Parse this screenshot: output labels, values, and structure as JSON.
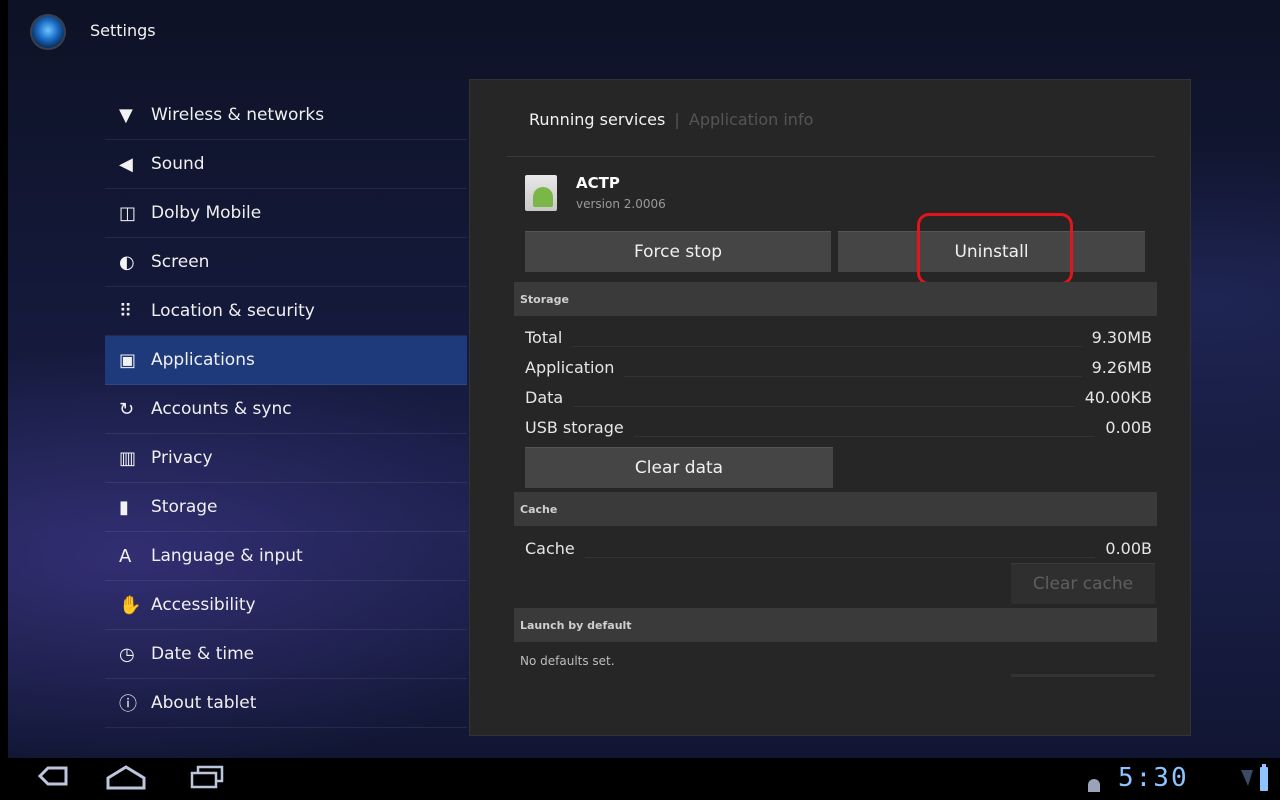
{
  "titlebar": {
    "title": "Settings"
  },
  "nav": {
    "items": [
      {
        "icon": "▼",
        "icon_name": "wifi-icon",
        "label": "Wireless & networks"
      },
      {
        "icon": "◀",
        "icon_name": "speaker-icon",
        "label": "Sound"
      },
      {
        "icon": "◫",
        "icon_name": "dolby-icon",
        "label": "Dolby Mobile"
      },
      {
        "icon": "◐",
        "icon_name": "brightness-icon",
        "label": "Screen"
      },
      {
        "icon": "⠿",
        "icon_name": "lock-grid-icon",
        "label": "Location & security"
      },
      {
        "icon": "▣",
        "icon_name": "applications-icon",
        "label": "Applications"
      },
      {
        "icon": "↻",
        "icon_name": "sync-icon",
        "label": "Accounts & sync"
      },
      {
        "icon": "▥",
        "icon_name": "privacy-icon",
        "label": "Privacy"
      },
      {
        "icon": "▮",
        "icon_name": "sd-card-icon",
        "label": "Storage"
      },
      {
        "icon": "A",
        "icon_name": "keyboard-icon",
        "label": "Language & input"
      },
      {
        "icon": "✋",
        "icon_name": "hand-icon",
        "label": "Accessibility"
      },
      {
        "icon": "◷",
        "icon_name": "clock-icon",
        "label": "Date & time"
      },
      {
        "icon": "ⓘ",
        "icon_name": "info-icon",
        "label": "About tablet"
      }
    ],
    "active_index": 5
  },
  "panel": {
    "breadcrumb": {
      "current": "Running services",
      "separator": "|",
      "next": "Application info"
    },
    "app": {
      "name": "ACTP",
      "version": "version 2.0006"
    },
    "buttons": {
      "force_stop": "Force stop",
      "uninstall": "Uninstall",
      "clear_data": "Clear data",
      "clear_cache": "Clear cache"
    },
    "storage": {
      "header": "Storage",
      "rows": [
        {
          "label": "Total",
          "value": "9.30MB"
        },
        {
          "label": "Application",
          "value": "9.26MB"
        },
        {
          "label": "Data",
          "value": "40.00KB"
        },
        {
          "label": "USB storage",
          "value": "0.00B"
        }
      ]
    },
    "cache": {
      "header": "Cache",
      "rows": [
        {
          "label": "Cache",
          "value": "0.00B"
        }
      ]
    },
    "launch": {
      "header": "Launch by default",
      "text": "No defaults set."
    }
  },
  "system_bar": {
    "time": "5:30",
    "back_icon": "back-icon",
    "home_icon": "home-icon",
    "recents_icon": "recents-icon"
  },
  "colors": {
    "accent": "#1e3a7a",
    "highlight": "#e0161b",
    "clock": "#8ec3ff"
  }
}
